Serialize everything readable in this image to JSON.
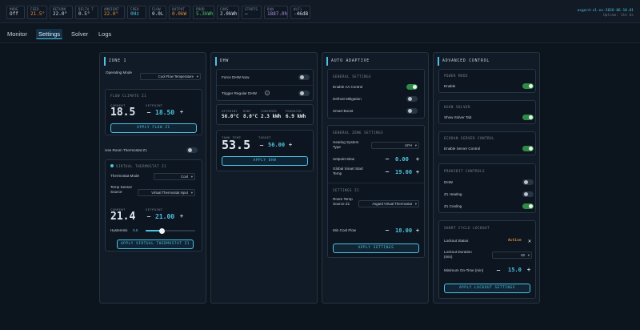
{
  "status_bar": [
    {
      "label": "MODE",
      "value": "Off",
      "tone": "ok"
    },
    {
      "label": "FEED",
      "value": "21.5°",
      "tone": "warn"
    },
    {
      "label": "RETURN",
      "value": "22.0°",
      "tone": "ok"
    },
    {
      "label": "DELTA T",
      "value": "0.5°",
      "tone": "ok"
    },
    {
      "label": "AMBIENT",
      "value": "22.0°",
      "tone": "warn"
    },
    {
      "label": "FREQ",
      "value": "0Hz",
      "tone": "cyan"
    },
    {
      "label": "FLOW",
      "value": "0.0L",
      "tone": "ok"
    },
    {
      "label": "OUTPUT",
      "value": "0.0kW",
      "tone": "warn"
    },
    {
      "label": "PROD",
      "value": "5.3kWh",
      "tone": "green"
    },
    {
      "label": "CONS",
      "value": "2.0kWh",
      "tone": "ok"
    },
    {
      "label": "STARTS",
      "value": "—",
      "tone": "ok"
    },
    {
      "label": "RUN",
      "value": "1887.0h",
      "tone": "purple"
    },
    {
      "label": "WiFi",
      "value": "-46dB",
      "tone": "ok"
    }
  ],
  "host": {
    "name": "asgard-z1-ex-2026-06-10.01",
    "uptime": "Uptime: 1te 6s"
  },
  "nav": {
    "tabs": [
      {
        "label": "Monitor",
        "active": false
      },
      {
        "label": "Settings",
        "active": true
      },
      {
        "label": "Solver",
        "active": false
      },
      {
        "label": "Logs",
        "active": false
      }
    ]
  },
  "zone1": {
    "title": "ZONE 1",
    "op_mode_label": "Operating Mode",
    "op_mode_value": "Cool Flow Temperature",
    "flow_climate_title": "FLOW CLIMATE Z1",
    "current_label": "CURRENT",
    "current": "18.5",
    "setpoint_label": "SETPOINT",
    "setpoint": "18.50",
    "apply_flow": "APPLY FLOW Z1",
    "use_room_thermostat": "Use Room Thermostat Z1",
    "vt_title": "VIRTUAL THERMOSTAT Z1",
    "thermostat_mode_label": "Thermostat Mode",
    "thermostat_mode_value": "Cool",
    "temp_source_label": "Temp Sensor Source",
    "temp_source_value": "Virtual Thermostat Input",
    "vt_current": "21.4",
    "vt_setpoint": "21.00",
    "hysteresis_label": "Hysteresis",
    "hysteresis_value": "0.5",
    "hysteresis_fraction": 0.33,
    "apply_vt": "APPLY VIRTUAL THERMOSTAT Z1"
  },
  "dhw": {
    "title": "DHW",
    "force_label": "Force DHW Now",
    "trigger_label": "Trigger Regular DHW",
    "stats": [
      {
        "k": "SETPOINT",
        "v": "56.0°C"
      },
      {
        "k": "DHWT",
        "v": "8.0°C"
      },
      {
        "k": "CONSUMED",
        "v": "2.3 kWh"
      },
      {
        "k": "PRODUCED",
        "v": "6.9 kWh"
      }
    ],
    "tank_label": "TANK TEMP",
    "tank": "53.5",
    "target_label": "TARGET",
    "target": "56.00",
    "apply": "APPLY DHW"
  },
  "auto": {
    "title": "AUTO ADAPTIVE",
    "general_title": "GENERAL SETTINGS",
    "enable_aa": "Enable AA Control",
    "defrost": "Defrost Mitigation",
    "smart_boost": "Smart Boost",
    "gzs_title": "GENERAL ZONE SETTINGS",
    "heating_type_label": "Heating System Type",
    "heating_type_value": "UFH",
    "setpoint_bias_label": "Setpoint Bias",
    "setpoint_bias": "0.00",
    "global_start_label": "Global Smart Start Temp",
    "global_start": "19.00",
    "settings_z1_title": "SETTINGS Z1",
    "room_temp_source_label": "Room Temp Source Z1",
    "room_temp_source_value": "Asgard Virtual Thermostat",
    "min_cool_flow_label": "Min Cool Flow",
    "min_cool_flow": "18.00",
    "apply": "APPLY SETTINGS"
  },
  "advanced": {
    "title": "ADVANCED CONTROL",
    "power_mode_title": "POWER MODE",
    "enable": "Enable",
    "ogon_title": "OGON SOLVER",
    "show_solver": "Show Solver Tab",
    "ecodan_title": "ECODAN SERVER CONTROL",
    "enable_server": "Enable Server Control",
    "prohibit_title": "PROHIBIT CONTROLS",
    "dhw": "DHW",
    "z1_heating": "Z1 Heating",
    "z1_cooling": "Z1 Cooling",
    "short_cycle_title": "SHORT CYCLE LOCKOUT",
    "lockout_status_label": "Lockout Status",
    "lockout_status": "Active",
    "lockout_duration_label": "Lockout Duration (min)",
    "lockout_duration": "60",
    "min_on_time_label": "Minimum On-Time (min)",
    "min_on_time": "15.0",
    "apply": "APPLY LOCKOUT SETTINGS"
  },
  "toggles": {
    "z1_room": false,
    "dhw_force": false,
    "dhw_trigger": false,
    "aa_enable": true,
    "aa_defrost": false,
    "aa_boost": false,
    "adv_enable": true,
    "adv_solver": true,
    "adv_server": true,
    "pro_dhw": false,
    "pro_heat": false,
    "pro_cool": true
  },
  "colors": {
    "accent": "#4fc1e0",
    "bg": "#0c141e",
    "card": "#111b27",
    "on": "#2f8a45",
    "warn": "#e58e3c",
    "active": "#e58e3c"
  }
}
